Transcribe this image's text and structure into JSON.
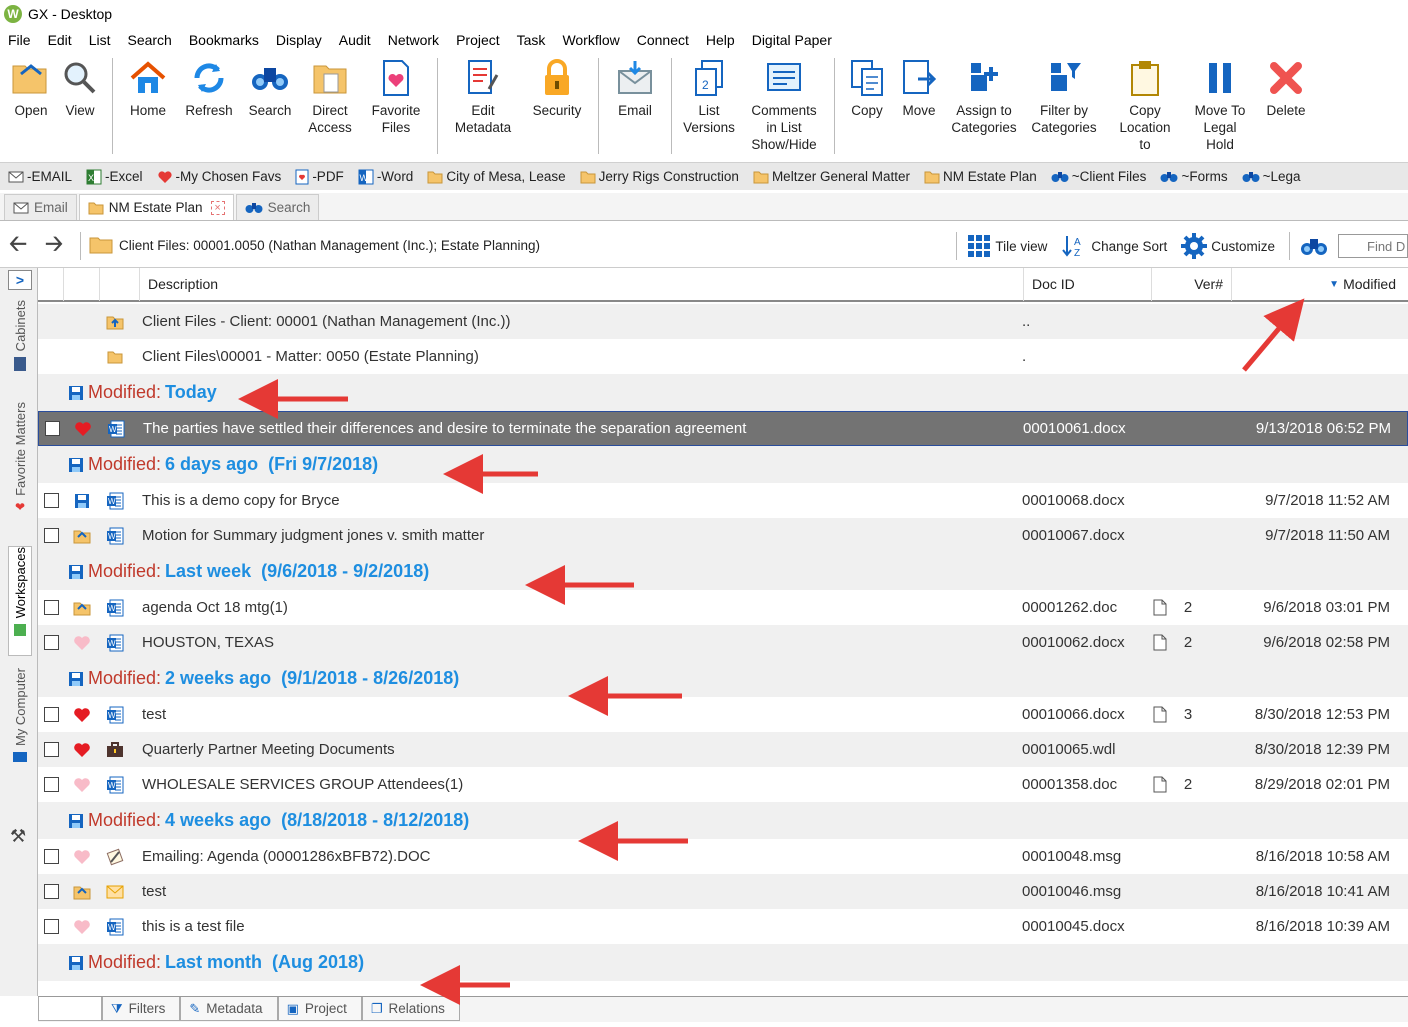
{
  "window": {
    "title": "GX - Desktop",
    "logo": "W"
  },
  "menu": [
    "File",
    "Edit",
    "List",
    "Search",
    "Bookmarks",
    "Display",
    "Audit",
    "Network",
    "Project",
    "Task",
    "Workflow",
    "Connect",
    "Help",
    "Digital Paper"
  ],
  "ribbon": {
    "groups": [
      [
        {
          "label": "Open",
          "icon": "open-folder-icon"
        },
        {
          "label": "View",
          "icon": "magnifier-icon"
        }
      ],
      [
        {
          "label": "Home",
          "icon": "home-icon"
        },
        {
          "label": "Refresh",
          "icon": "refresh-icon"
        },
        {
          "label": "Search",
          "icon": "binoculars-icon"
        },
        {
          "label": "Direct\nAccess",
          "icon": "direct-access-icon"
        },
        {
          "label": "Favorite\nFiles",
          "icon": "favorite-files-icon"
        }
      ],
      [
        {
          "label": "Edit\nMetadata",
          "icon": "edit-metadata-icon"
        },
        {
          "label": "Security",
          "icon": "lock-icon"
        }
      ],
      [
        {
          "label": "Email",
          "icon": "email-icon"
        }
      ],
      [
        {
          "label": "List\nVersions",
          "icon": "list-versions-icon"
        },
        {
          "label": "Comments\nin List\nShow/Hide",
          "icon": "comments-icon"
        }
      ],
      [
        {
          "label": "Copy",
          "icon": "copy-icon"
        },
        {
          "label": "Move",
          "icon": "move-icon"
        },
        {
          "label": "Assign to\nCategories",
          "icon": "assign-categories-icon"
        },
        {
          "label": "Filter by\nCategories",
          "icon": "filter-categories-icon"
        },
        {
          "label": "Copy\nLocation\nto",
          "icon": "clipboard-icon"
        },
        {
          "label": "Move To\nLegal\nHold",
          "icon": "pause-icon"
        },
        {
          "label": "Delete",
          "icon": "delete-x-icon"
        }
      ]
    ]
  },
  "favorites": [
    {
      "label": "-EMAIL",
      "icon": "email-icon"
    },
    {
      "label": "-Excel",
      "icon": "excel-icon"
    },
    {
      "label": "-My Chosen Favs",
      "icon": "heart-icon"
    },
    {
      "label": "-PDF",
      "icon": "pdf-icon"
    },
    {
      "label": "-Word",
      "icon": "word-icon"
    },
    {
      "label": "City of Mesa, Lease",
      "icon": "folder-icon"
    },
    {
      "label": "Jerry Rigs Construction",
      "icon": "folder-icon"
    },
    {
      "label": "Meltzer General Matter",
      "icon": "folder-icon"
    },
    {
      "label": "NM Estate Plan",
      "icon": "folder-icon"
    },
    {
      "label": "~Client Files",
      "icon": "binoculars-icon"
    },
    {
      "label": "~Forms",
      "icon": "binoculars-icon"
    },
    {
      "label": "~Lega",
      "icon": "binoculars-icon"
    }
  ],
  "tabs": [
    {
      "label": "Email",
      "active": false
    },
    {
      "label": "NM Estate Plan",
      "active": true
    },
    {
      "label": "Search",
      "active": false
    }
  ],
  "address": {
    "path": "Client Files: 00001.0050 (Nathan Management (Inc.); Estate Planning)",
    "tile_view": "Tile view",
    "change_sort": "Change Sort",
    "customize": "Customize",
    "find_placeholder": "Find D"
  },
  "left_tabs": [
    "Cabinets",
    "Favorite Matters",
    "Workspaces",
    "My Computer"
  ],
  "columns": {
    "description": "Description",
    "docid": "Doc ID",
    "ver": "Ver#",
    "modified": "Modified"
  },
  "parent_rows": [
    {
      "desc": "Client Files - Client: 00001 (Nathan Management (Inc.))",
      "docid": ".."
    },
    {
      "desc": "Client Files\\00001 - Matter: 0050 (Estate Planning)",
      "docid": "."
    }
  ],
  "groups": [
    {
      "label": "Modified:",
      "value": "Today",
      "rows": [
        {
          "fav": "heart-red",
          "type": "word",
          "desc": "The parties have settled their differences and desire to terminate the separation agreement",
          "docid": "00010061.docx",
          "ver": "",
          "page": false,
          "modified": "9/13/2018 06:52 PM",
          "selected": true
        }
      ]
    },
    {
      "label": "Modified:",
      "value": "6 days ago  (Fri 9/7/2018)",
      "rows": [
        {
          "fav": "save",
          "type": "word",
          "desc": "This is a demo copy for Bryce",
          "docid": "00010068.docx",
          "ver": "",
          "page": false,
          "modified": "9/7/2018 11:52 AM"
        },
        {
          "fav": "open",
          "type": "word",
          "desc": "Motion for Summary judgment jones v. smith matter",
          "docid": "00010067.docx",
          "ver": "",
          "page": false,
          "modified": "9/7/2018 11:50 AM"
        }
      ]
    },
    {
      "label": "Modified:",
      "value": "Last week  (9/6/2018 - 9/2/2018)",
      "rows": [
        {
          "fav": "open",
          "type": "word",
          "desc": "agenda Oct 18 mtg(1)",
          "docid": "00001262.doc",
          "ver": "2",
          "page": true,
          "modified": "9/6/2018 03:01 PM"
        },
        {
          "fav": "heart-pink",
          "type": "word",
          "desc": "HOUSTON, TEXAS",
          "docid": "00010062.docx",
          "ver": "2",
          "page": true,
          "modified": "9/6/2018 02:58 PM"
        }
      ]
    },
    {
      "label": "Modified:",
      "value": "2 weeks ago  (9/1/2018 - 8/26/2018)",
      "rows": [
        {
          "fav": "heart-red",
          "type": "word",
          "desc": "test",
          "docid": "00010066.docx",
          "ver": "3",
          "page": true,
          "modified": "8/30/2018 12:53 PM"
        },
        {
          "fav": "heart-red",
          "type": "briefcase",
          "desc": "Quarterly Partner Meeting Documents",
          "docid": "00010065.wdl",
          "ver": "",
          "page": false,
          "modified": "8/30/2018 12:39 PM"
        },
        {
          "fav": "heart-pink",
          "type": "word",
          "desc": "WHOLESALE SERVICES GROUP Attendees(1)",
          "docid": "00001358.doc",
          "ver": "2",
          "page": true,
          "modified": "8/29/2018 02:01 PM"
        }
      ]
    },
    {
      "label": "Modified:",
      "value": "4 weeks ago  (8/18/2018 - 8/12/2018)",
      "rows": [
        {
          "fav": "heart-pink",
          "type": "attach",
          "desc": "Emailing: Agenda (00001286xBFB72).DOC",
          "docid": "00010048.msg",
          "ver": "",
          "page": false,
          "modified": "8/16/2018 10:58 AM"
        },
        {
          "fav": "open",
          "type": "envelope",
          "desc": "test",
          "docid": "00010046.msg",
          "ver": "",
          "page": false,
          "modified": "8/16/2018 10:41 AM"
        },
        {
          "fav": "heart-pink",
          "type": "word",
          "desc": "this is a test file",
          "docid": "00010045.docx",
          "ver": "",
          "page": false,
          "modified": "8/16/2018 10:39 AM"
        }
      ]
    },
    {
      "label": "Modified:",
      "value": "Last month  (Aug 2018)",
      "rows": []
    }
  ],
  "bottom_tabs": [
    "Filters",
    "Metadata",
    "Project",
    "Relations"
  ],
  "colors": {
    "accent_blue": "#1e8ee0",
    "group_label_red": "#c0392b",
    "annotation_arrow": "#e53935",
    "selected_row": "#737373"
  }
}
